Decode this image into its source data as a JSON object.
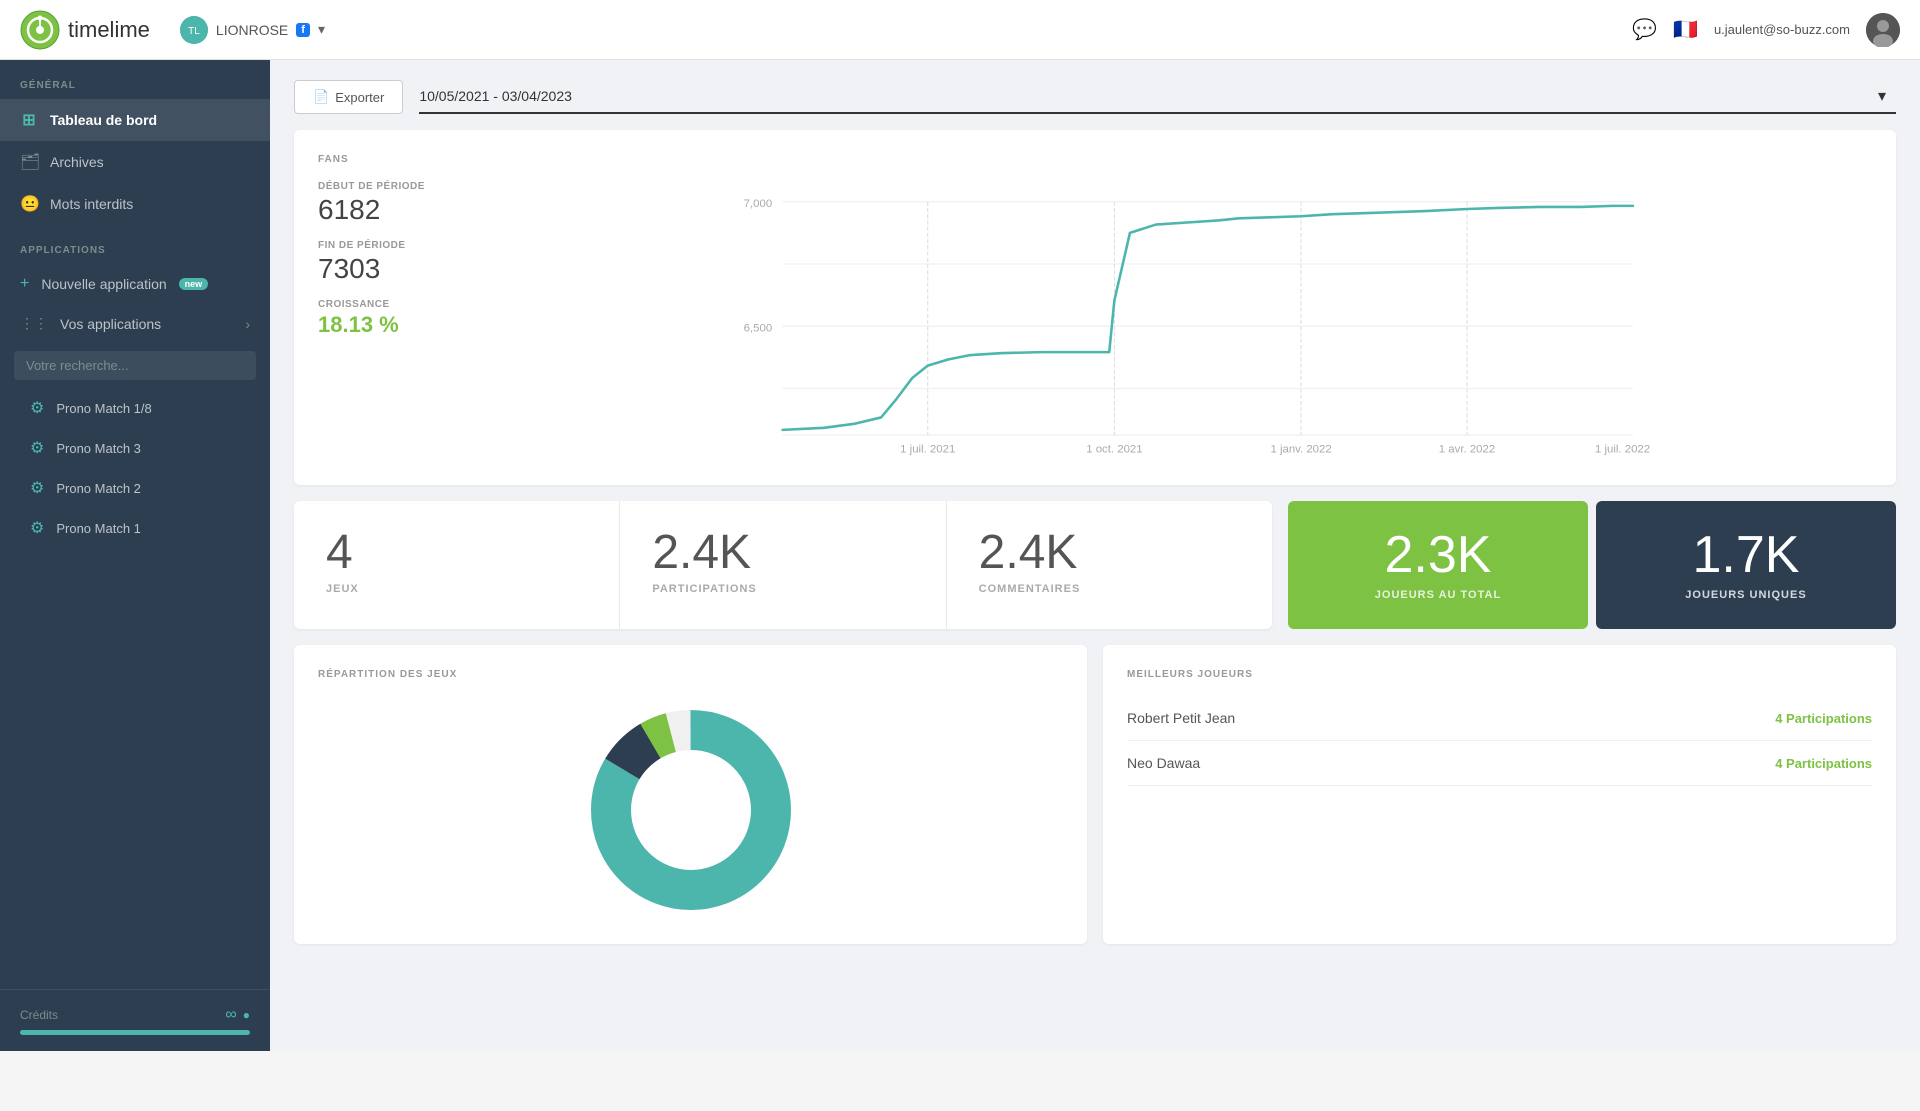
{
  "topnav": {
    "logo_text": "timelime",
    "brand_name": "LIONROSE",
    "user_email": "u.jaulent@so-buzz.com",
    "chat_icon": "💬",
    "flag": "🇫🇷"
  },
  "toolbar": {
    "export_label": "Exporter",
    "date_range": "10/05/2021 - 03/04/2023"
  },
  "sidebar": {
    "general_label": "GÉNÉRAL",
    "tableau_de_bord": "Tableau de bord",
    "archives": "Archives",
    "mots_interdits": "Mots interdits",
    "applications_label": "APPLICATIONS",
    "nouvelle_application": "Nouvelle application",
    "new_badge": "new",
    "vos_applications": "Vos applications",
    "search_placeholder": "Votre recherche...",
    "apps": [
      {
        "name": "Prono Match 1/8"
      },
      {
        "name": "Prono Match 3"
      },
      {
        "name": "Prono Match 2"
      },
      {
        "name": "Prono Match 1"
      }
    ],
    "credits_label": "Crédits",
    "credits_symbol": "∞"
  },
  "fans_card": {
    "title": "FANS",
    "debut_label": "DÉBUT DE PÉRIODE",
    "debut_value": "6182",
    "fin_label": "FIN DE PÉRIODE",
    "fin_value": "7303",
    "croissance_label": "CROISSANCE",
    "croissance_value": "18.13 %",
    "chart": {
      "x_labels": [
        "1 juil. 2021",
        "1 oct. 2021",
        "1 janv. 2022",
        "1 avr. 2022",
        "1 juil. 2022"
      ],
      "y_labels": [
        "7,000",
        "6,500"
      ],
      "y_min": 6180,
      "y_max": 7350
    }
  },
  "stats": {
    "jeux_value": "4",
    "jeux_label": "JEUX",
    "participations_value": "2.4K",
    "participations_label": "PARTICIPATIONS",
    "commentaires_value": "2.4K",
    "commentaires_label": "COMMENTAIRES",
    "joueurs_total_value": "2.3K",
    "joueurs_total_label": "JOUEURS AU TOTAL",
    "joueurs_uniques_value": "1.7K",
    "joueurs_uniques_label": "JOUEURS UNIQUES"
  },
  "repartition": {
    "title": "RÉPARTITION DES JEUX"
  },
  "meilleurs": {
    "title": "MEILLEURS JOUEURS",
    "players": [
      {
        "name": "Robert Petit Jean",
        "score": "4 Participations"
      },
      {
        "name": "Neo Dawaa",
        "score": "4 Participations"
      }
    ]
  }
}
